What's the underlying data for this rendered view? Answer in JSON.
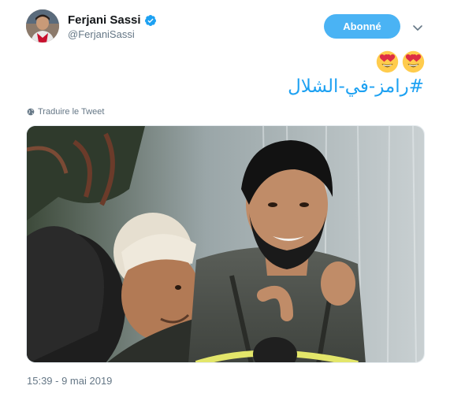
{
  "author": {
    "name": "Ferjani Sassi",
    "handle": "@FerjaniSassi",
    "verified_icon": "verified-badge-icon",
    "avatar_icon": "avatar"
  },
  "header": {
    "follow_label": "Abonné",
    "menu_icon": "chevron-down-icon"
  },
  "tweet": {
    "emojis": [
      "heart-eyes-emoji",
      "heart-eyes-emoji"
    ],
    "hashtag_prefix": "#",
    "hashtag_text": "رامز-في-الشلال",
    "translate_label": "Traduire le Tweet"
  },
  "media": {
    "type": "photo"
  },
  "timestamp": "15:39 - 9 mai 2019",
  "colors": {
    "accent": "#1da1f2",
    "follow_button": "#4ab3f4",
    "secondary_text": "#657786"
  }
}
